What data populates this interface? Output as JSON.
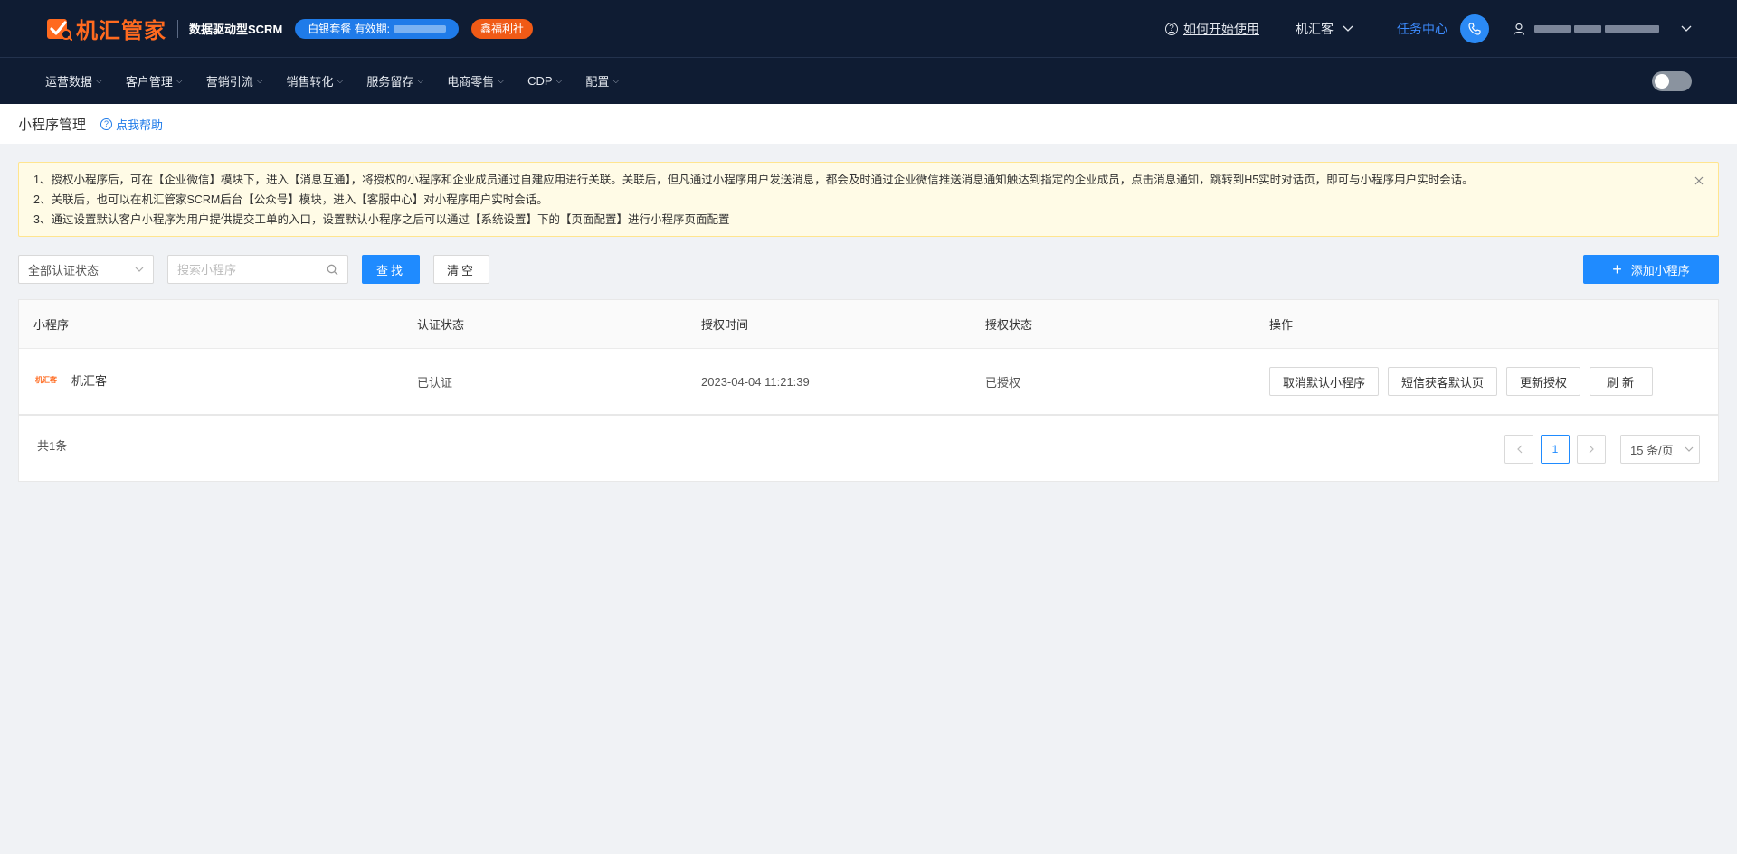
{
  "header": {
    "brand": "机汇管家",
    "subtitle": "数据驱动型SCRM",
    "package_badge": "白银套餐 有效期:",
    "vip_badge": "鑫福利社",
    "help_link": "如何开始使用",
    "org_name": "机汇客",
    "task_center": "任务中心"
  },
  "nav": {
    "items": [
      {
        "label": "运营数据"
      },
      {
        "label": "客户管理"
      },
      {
        "label": "营销引流"
      },
      {
        "label": "销售转化"
      },
      {
        "label": "服务留存"
      },
      {
        "label": "电商零售"
      },
      {
        "label": "CDP"
      },
      {
        "label": "配置"
      }
    ]
  },
  "page": {
    "title": "小程序管理",
    "help": "点我帮助"
  },
  "notice": {
    "lines": [
      "1、授权小程序后，可在【企业微信】模块下，进入【消息互通】，将授权的小程序和企业成员通过自建应用进行关联。关联后，但凡通过小程序用户发送消息，都会及时通过企业微信推送消息通知触达到指定的企业成员，点击消息通知，跳转到H5实时对话页，即可与小程序用户实时会话。",
      "2、关联后，也可以在机汇管家SCRM后台【公众号】模块，进入【客服中心】对小程序用户实时会话。",
      "3、通过设置默认客户小程序为用户提供提交工单的入口，设置默认小程序之后可以通过【系统设置】下的【页面配置】进行小程序页面配置"
    ]
  },
  "filters": {
    "status_select": "全部认证状态",
    "search_placeholder": "搜索小程序",
    "search_button": "查找",
    "clear_button": "清空",
    "add_button": "添加小程序"
  },
  "table": {
    "columns": [
      "小程序",
      "认证状态",
      "授权时间",
      "授权状态",
      "操作"
    ],
    "rows": [
      {
        "logo_text": "机汇客",
        "name": "机汇客",
        "cert_status": "已认证",
        "auth_time": "2023-04-04 11:21:39",
        "auth_status": "已授权",
        "actions": [
          "取消默认小程序",
          "短信获客默认页",
          "更新授权",
          "刷新"
        ]
      }
    ]
  },
  "pagination": {
    "total_text": "共1条",
    "current_page": "1",
    "page_size": "15 条/页"
  },
  "colors": {
    "header_bg": "#0f1c33",
    "brand_orange": "#ff6a1f",
    "primary_blue": "#1f8bff",
    "notice_bg": "#fffbe6"
  }
}
